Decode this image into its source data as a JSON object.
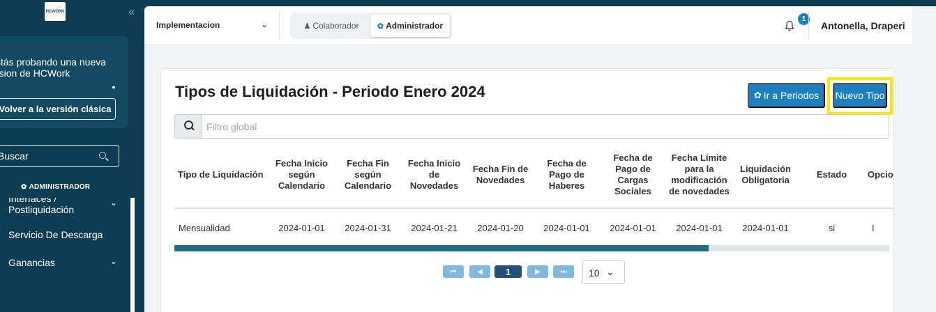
{
  "sidebar": {
    "logo_text": "HCWORK",
    "collapse_glyph": "«",
    "notice_text": "stás probando una nueva rsion de HCWork",
    "classic_button": "Volver a la versión clásica",
    "search_placeholder": "Buscar",
    "role_label": "ADMINISTRADOR",
    "menu": [
      {
        "label": "Interfaces / Postliquidación",
        "has_children": true
      },
      {
        "label": "Servicio De Descarga",
        "has_children": false
      },
      {
        "label": "Ganancias",
        "has_children": true
      }
    ]
  },
  "topbar": {
    "org_select": "Implementacion",
    "role_colaborador": "Colaborador",
    "role_administrador": "Administrador",
    "notification_count": "1",
    "user_name": "Antonella, Draperi"
  },
  "page": {
    "title": "Tipos de Liquidación - Periodo Enero 2024",
    "btn_periodos": "Ir a Periodos",
    "btn_nuevo": "Nuevo Tipo",
    "filter_placeholder": "Filtro global"
  },
  "table": {
    "headers": [
      "Tipo de Liquidación",
      "Fecha Inicio según Calendario",
      "Fecha Fin según Calendario",
      "Fecha Inicio de Novedades",
      "Fecha Fin de Novedades",
      "Fecha de Pago de Haberes",
      "Fecha de Pago de Cargas Sociales",
      "Fecha Límite para la modificación de novedades",
      "Liquidación Obligatoria",
      "Estado",
      "Opciones"
    ],
    "rows": [
      [
        "Mensualidad",
        "2024-01-01",
        "2024-01-31",
        "2024-01-21",
        "2024-01-20",
        "2024-01-01",
        "2024-01-01",
        "2024-01-01",
        "2024-01-01",
        "si",
        "I"
      ]
    ],
    "horizontal_scroll_fraction": 0.75
  },
  "pagination": {
    "first": "⏮",
    "prev": "◀",
    "current": "1",
    "next": "▶",
    "last": "⏭",
    "page_size": "10"
  },
  "colors": {
    "sidebar_bg": "#0c3d52",
    "primary": "#1b7fc0",
    "highlight": "#f5ea00",
    "scroll_thumb": "#206e86"
  }
}
